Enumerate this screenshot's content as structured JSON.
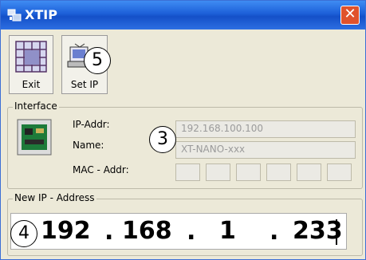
{
  "window": {
    "title": "XTIP",
    "close_glyph": "✕"
  },
  "toolbar": {
    "exit_label": "Exit",
    "setip_label": "Set IP"
  },
  "interface": {
    "group_title": "Interface",
    "ip_label": "IP-Addr:",
    "ip_value": "192.168.100.100",
    "name_label": "Name:",
    "name_value": "XT-NANO-xxx",
    "mac_label": "MAC - Addr:"
  },
  "new_ip": {
    "group_title": "New IP - Address",
    "octets": [
      "192",
      "168",
      "1",
      "233"
    ],
    "separator": "."
  },
  "callouts": {
    "c3": "3",
    "c4": "4",
    "c5": "5"
  },
  "icons": [
    "window-app-icon",
    "exit-grid-icon",
    "set-ip-icon",
    "network-card-icon",
    "close-icon"
  ],
  "colors": {
    "title_bar": "#1c5fd8",
    "close_button": "#e0522c",
    "window_bg": "#ece9d8"
  }
}
